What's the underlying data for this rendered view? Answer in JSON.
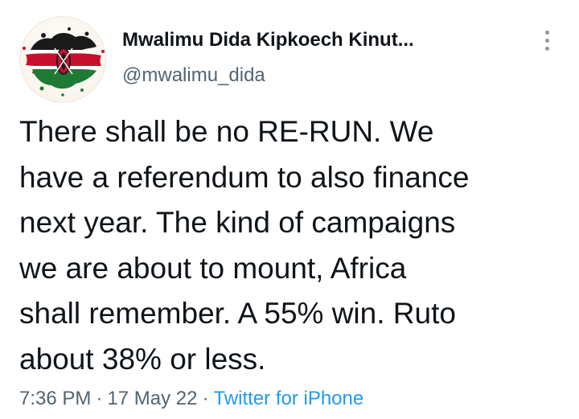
{
  "author": {
    "display_name": "Mwalimu Dida Kipkoech Kinut...",
    "handle": "@mwalimu_dida",
    "avatar_icon": "kenya-flag-splatter-avatar"
  },
  "tweet": {
    "text": "There shall be no RE-RUN. We\nhave a referendum to also finance\nnext year. The kind of campaigns\nwe are about to mount, Africa\nshall remember. A 55% win. Ruto\nabout 38% or less."
  },
  "meta": {
    "time": "7:36 PM",
    "separator": "·",
    "date": "17 May 22",
    "source": "Twitter for iPhone"
  },
  "colors": {
    "text": "#0f1419",
    "secondary": "#536471",
    "link": "#1d9bf0"
  }
}
